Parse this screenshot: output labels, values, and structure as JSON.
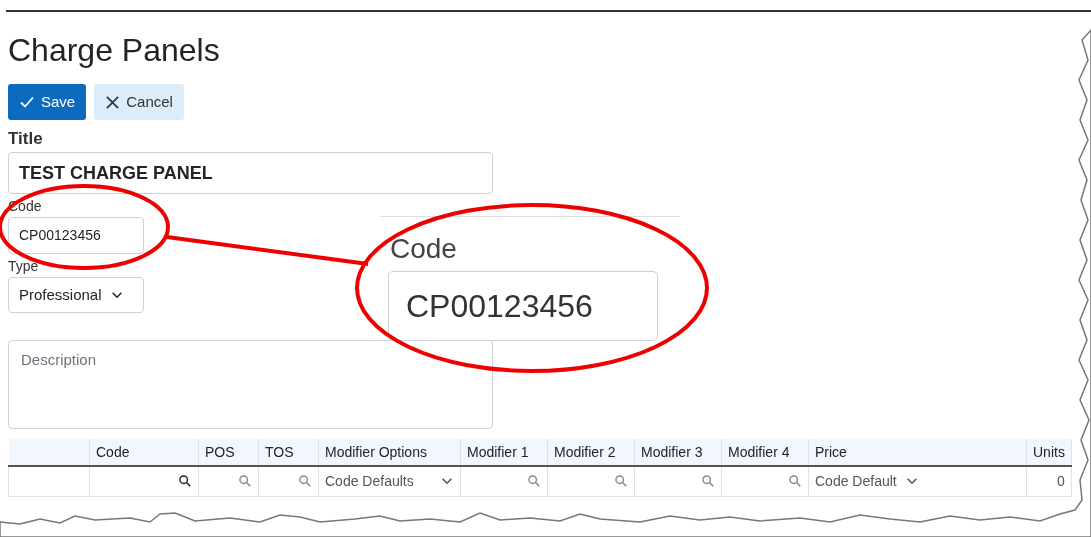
{
  "page": {
    "title": "Charge Panels"
  },
  "toolbar": [
    {
      "kind": "save",
      "label": "Save"
    },
    {
      "kind": "cancel",
      "label": "Cancel"
    }
  ],
  "form": {
    "title": {
      "label": "Title",
      "value": "TEST CHARGE PANEL"
    },
    "code": {
      "label": "Code",
      "value": "CP00123456"
    },
    "type": {
      "label": "Type",
      "value": "Professional"
    },
    "description": {
      "placeholder": "Description"
    }
  },
  "callout": {
    "label": "Code",
    "value": "CP00123456"
  },
  "table": {
    "columns": [
      "",
      "Code",
      "POS",
      "TOS",
      "Modifier Options",
      "Modifier 1",
      "Modifier 2",
      "Modifier 3",
      "Modifier 4",
      "Price",
      "Units"
    ],
    "filters": [
      {
        "kind": "blank"
      },
      {
        "kind": "search",
        "active": true
      },
      {
        "kind": "search",
        "active": false
      },
      {
        "kind": "search",
        "active": false
      },
      {
        "kind": "select",
        "value": "Code Defaults"
      },
      {
        "kind": "search",
        "active": false
      },
      {
        "kind": "search",
        "active": false
      },
      {
        "kind": "search",
        "active": false
      },
      {
        "kind": "search",
        "active": false
      },
      {
        "kind": "select",
        "value": "Code Default"
      },
      {
        "kind": "text",
        "value": "0"
      }
    ]
  }
}
